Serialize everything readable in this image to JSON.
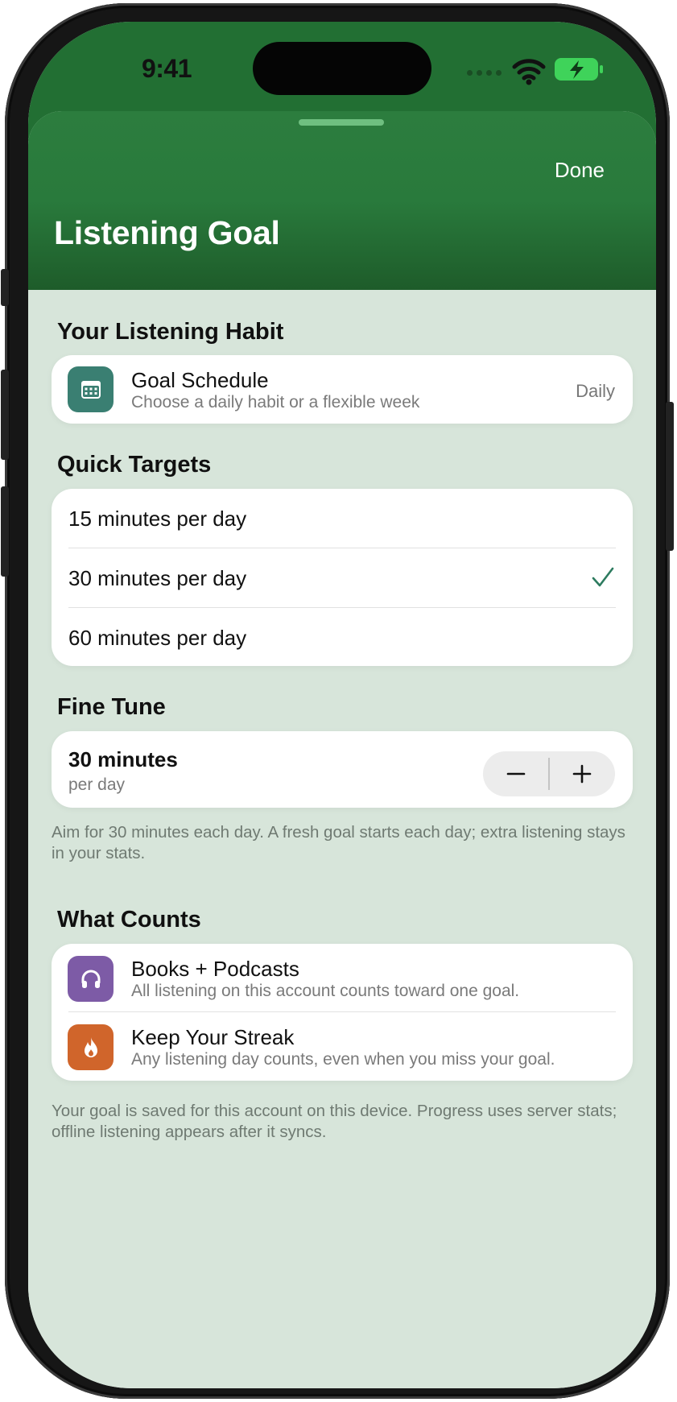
{
  "status_bar": {
    "time": "9:41"
  },
  "header": {
    "title": "Listening Goal",
    "done_label": "Done"
  },
  "colors": {
    "header_green": "#297a3c",
    "sheet_background": "#d7e5da",
    "accent": "#2d7b5f",
    "schedule_icon_bg": "#3a7f72",
    "books_icon_bg": "#7d5ba6",
    "streak_icon_bg": "#d0652b"
  },
  "habit_section": {
    "title": "Your Listening Habit",
    "schedule": {
      "icon": "calendar-icon",
      "title": "Goal Schedule",
      "subtitle": "Choose a daily habit or a flexible week",
      "value": "Daily"
    }
  },
  "targets_section": {
    "title": "Quick Targets",
    "options": [
      {
        "label": "15 minutes per day",
        "selected": false
      },
      {
        "label": "30 minutes per day",
        "selected": true
      },
      {
        "label": "60 minutes per day",
        "selected": false
      }
    ],
    "selected_icon": "checkmark-icon"
  },
  "fine_tune_section": {
    "title": "Fine Tune",
    "value": "30 minutes",
    "unit": "per day",
    "decrement_icon": "minus-icon",
    "increment_icon": "plus-icon",
    "footnote": "Aim for 30 minutes each day. A fresh goal starts each day; extra listening stays in your stats."
  },
  "counts_section": {
    "title": "What Counts",
    "items": [
      {
        "icon": "headphones-icon",
        "title": "Books + Podcasts",
        "subtitle": "All listening on this account counts toward one goal."
      },
      {
        "icon": "flame-icon",
        "title": "Keep Your Streak",
        "subtitle": "Any listening day counts, even when you miss your goal."
      }
    ],
    "footnote": "Your goal is saved for this account on this device. Progress uses server stats; offline listening appears after it syncs."
  }
}
